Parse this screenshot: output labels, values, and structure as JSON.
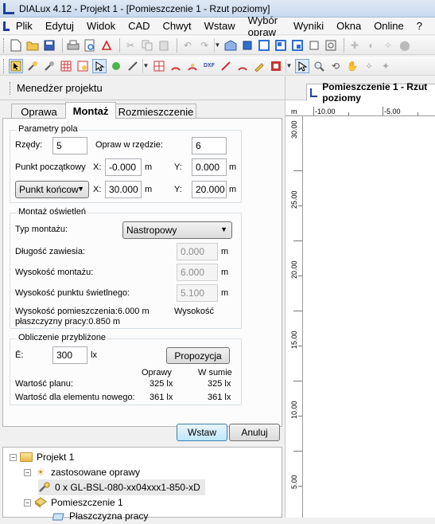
{
  "window": {
    "title": "DIALux 4.12 - Projekt 1 - [Pomieszczenie 1 - Rzut poziomy]"
  },
  "menu": [
    "Plik",
    "Edytuj",
    "Widok",
    "CAD",
    "Chwyt",
    "Wstaw",
    "Wybór opraw",
    "Wyniki",
    "Okna",
    "Online",
    "?"
  ],
  "toolbar1_icons": [
    "new-icon",
    "open-icon",
    "save-icon",
    "print-icon",
    "print-preview-icon",
    "pdf-icon",
    "cut-icon",
    "copy-icon",
    "paste-icon",
    "undo-icon",
    "redo-icon",
    "room-icon",
    "cube-icon",
    "front-view-icon",
    "side-view-icon",
    "view-icon",
    "3d-view-icon",
    "zoom-window-icon",
    "light-icon",
    "light2-icon",
    "light3-icon",
    "stop-icon"
  ],
  "toolbar2_icons": [
    "select-luminaire-icon",
    "rotate-luminaire-icon",
    "aim-luminaire-icon",
    "table-icon",
    "light-table-icon",
    "select-icon",
    "green-arrow-icon",
    "tilt-icon",
    "grid-icon",
    "arc-icon",
    "dwg-icon",
    "dxf-icon",
    "measure-icon",
    "dim-icon",
    "pencil-icon",
    "floor-icon",
    "pointer-icon",
    "magnifier-icon",
    "rotate-view-icon",
    "hand-icon",
    "walk-icon",
    "fly-icon"
  ],
  "manager": {
    "title": "Menedżer projektu"
  },
  "tabs": [
    "Oprawa",
    "Montaż",
    "Rozmieszczenie"
  ],
  "field_params": {
    "title": "Parametry pola",
    "rows_label": "Rzędy:",
    "rows_value": "5",
    "per_row_label": "Opraw w rzędzie:",
    "per_row_value": "6",
    "start_label": "Punkt początkowy",
    "x_label": "X:",
    "y_label": "Y:",
    "unit": "m",
    "start_x": "-0.000",
    "start_y": "0.000",
    "end_select": "Punkt końcow",
    "end_x": "30.000",
    "end_y": "20.000"
  },
  "mounting": {
    "title": "Montaż oświetleń",
    "type_label": "Typ montażu:",
    "type_value": "Nastropowy",
    "suspension_label": "Długość zawiesia:",
    "suspension_value": "0.000",
    "height_label": "Wysokość montażu:",
    "height_value": "6.000",
    "light_point_label": "Wysokość punktu świetlnego:",
    "light_point_value": "5.100",
    "unit": "m",
    "room_height_text": "Wysokość pomieszczenia:6.000 m",
    "workplane_text_1": "Wysokość",
    "workplane_text_2": "płaszczyzny pracy:0.850 m"
  },
  "approx": {
    "title": "Obliczenie przybliżone",
    "e_label": "Ē:",
    "e_value": "300",
    "e_unit": "lx",
    "proposal_button": "Propozycja",
    "col1": "Oprawy",
    "col2": "W sumie",
    "plan_label": "Wartość planu:",
    "plan_v1": "325 lx",
    "plan_v2": "325 lx",
    "new_label": "Wartość dla elementu nowego:",
    "new_v1": "361 lx",
    "new_v2": "361 lx"
  },
  "actions": {
    "insert": "Wstaw",
    "cancel": "Anuluj"
  },
  "tree": {
    "project": "Projekt 1",
    "used": "zastosowane oprawy",
    "luminaire": "0 x GL-BSL-080-xx04xxx1-850-xD",
    "room": "Pomieszczenie 1",
    "workplane": "Płaszczyzna pracy"
  },
  "view": {
    "tab": "Pomieszczenie 1 - Rzut poziomy",
    "ruler_unit": "m",
    "x_ticks": [
      "-10.00",
      "-5.00"
    ],
    "y_ticks": [
      "30.00",
      "25.00",
      "20.00",
      "15.00",
      "10.00",
      "5.00"
    ]
  }
}
